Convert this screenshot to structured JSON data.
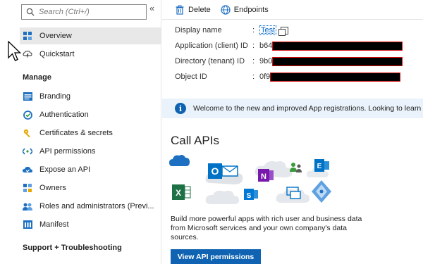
{
  "sidebar": {
    "search_placeholder": "Search (Ctrl+/)",
    "collapse_glyph": "«",
    "top_items": [
      {
        "label": "Overview",
        "icon": "overview-grid-icon"
      },
      {
        "label": "Quickstart",
        "icon": "cloud-bolt-icon"
      }
    ],
    "manage_heading": "Manage",
    "manage_items": [
      {
        "label": "Branding",
        "icon": "branding-icon"
      },
      {
        "label": "Authentication",
        "icon": "authentication-icon"
      },
      {
        "label": "Certificates & secrets",
        "icon": "key-icon"
      },
      {
        "label": "API permissions",
        "icon": "api-permissions-icon"
      },
      {
        "label": "Expose an API",
        "icon": "cloud-expose-icon"
      },
      {
        "label": "Owners",
        "icon": "owners-grid-icon"
      },
      {
        "label": "Roles and administrators (Previ...",
        "icon": "roles-icon"
      },
      {
        "label": "Manifest",
        "icon": "manifest-icon"
      }
    ],
    "support_heading": "Support + Troubleshooting"
  },
  "toolbar": {
    "delete_label": "Delete",
    "endpoints_label": "Endpoints"
  },
  "essentials": {
    "display_name_key": "Display name",
    "display_name_value": "Test",
    "app_id_key": "Application (client) ID",
    "app_id_prefix": "b64",
    "tenant_id_key": "Directory (tenant) ID",
    "tenant_id_prefix": "9b0",
    "object_id_key": "Object ID",
    "object_id_prefix": "0f9"
  },
  "banner": {
    "text": "Welcome to the new and improved App registrations. Looking to learn"
  },
  "call_apis": {
    "heading": "Call APIs",
    "description_line1": "Build more powerful apps with rich user and business data",
    "description_line2": "from Microsoft services and your own company's data",
    "description_line3": "sources.",
    "button_label": "View API permissions"
  },
  "colors": {
    "accent": "#0f63b2",
    "banner_bg": "#eaf3fb",
    "active_item_bg": "#e8e8e8"
  }
}
